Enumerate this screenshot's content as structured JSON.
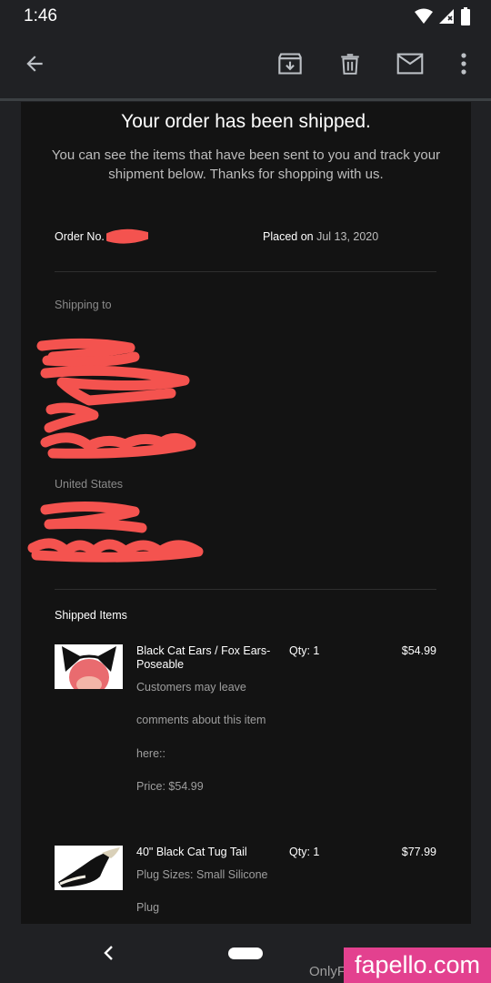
{
  "status_bar": {
    "time": "1:46"
  },
  "toolbar": {
    "icons": [
      "back-arrow-icon",
      "archive-icon",
      "delete-icon",
      "mark-unread-icon",
      "more-vert-icon"
    ]
  },
  "email": {
    "headline": "Your order has been shipped.",
    "intro": "You can see the items that have been sent to you and track your shipment below. Thanks for shopping with us.",
    "order_no_label": "Order No.",
    "placed_label": "Placed on",
    "placed_date": "Jul 13, 2020",
    "shipping_to_label": "Shipping to",
    "country": "United States",
    "shipped_items_title": "Shipped Items",
    "items": [
      {
        "name": "Black Cat Ears / Fox Ears- Poseable",
        "qty": "Qty: 1",
        "price": "$54.99",
        "desc": [
          "Customers may leave",
          "comments about this item",
          "here::",
          "Price: $54.99"
        ]
      },
      {
        "name": "40\" Black Cat Tug Tail",
        "qty": "Qty: 1",
        "price": "$77.99",
        "desc": [
          "Plug Sizes: Small Silicone",
          "Plug"
        ]
      }
    ]
  },
  "nav": {
    "partial_text": "OnlyF"
  },
  "watermark": "fapello.com",
  "colors": {
    "redaction": "#f4534f",
    "watermark_bg": "#e3418f",
    "background": "#202124",
    "email_bg": "#131313"
  }
}
